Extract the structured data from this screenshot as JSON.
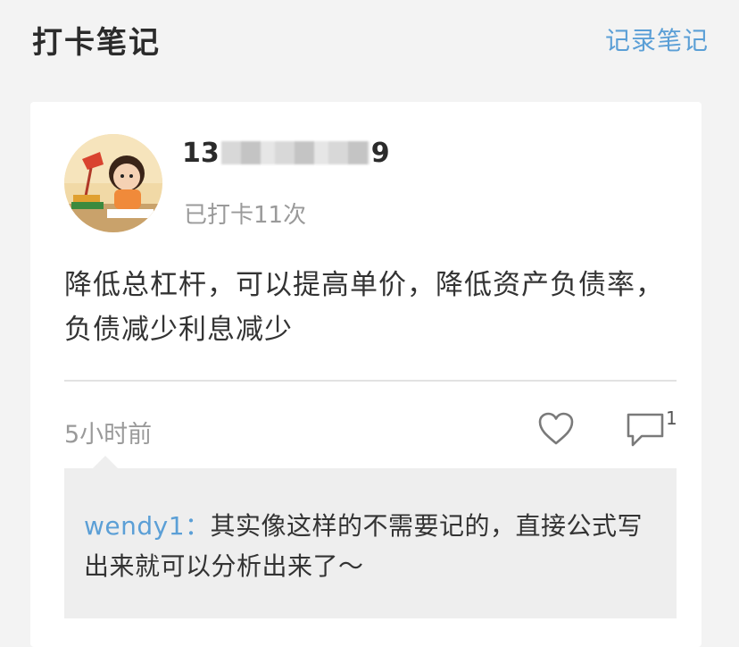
{
  "header": {
    "title": "打卡笔记",
    "record_link": "记录笔记"
  },
  "note": {
    "username_prefix": "13",
    "username_suffix": "9",
    "checkin_count": "已打卡11次",
    "body": "降低总杠杆，可以提高单价，降低资产负债率，负债减少利息减少",
    "time_ago": "5小时前",
    "comment_count": "1",
    "reply": {
      "author": "wendy1：",
      "text": "其实像这样的不需要记的，直接公式写出来就可以分析出来了～"
    }
  },
  "icons": {
    "like": "heart-outline-icon",
    "comment": "comment-bubble-icon"
  },
  "colors": {
    "accent": "#5b9fd6",
    "background": "#f3f3f3",
    "card": "#ffffff",
    "reply_bg": "#eeeeee"
  }
}
